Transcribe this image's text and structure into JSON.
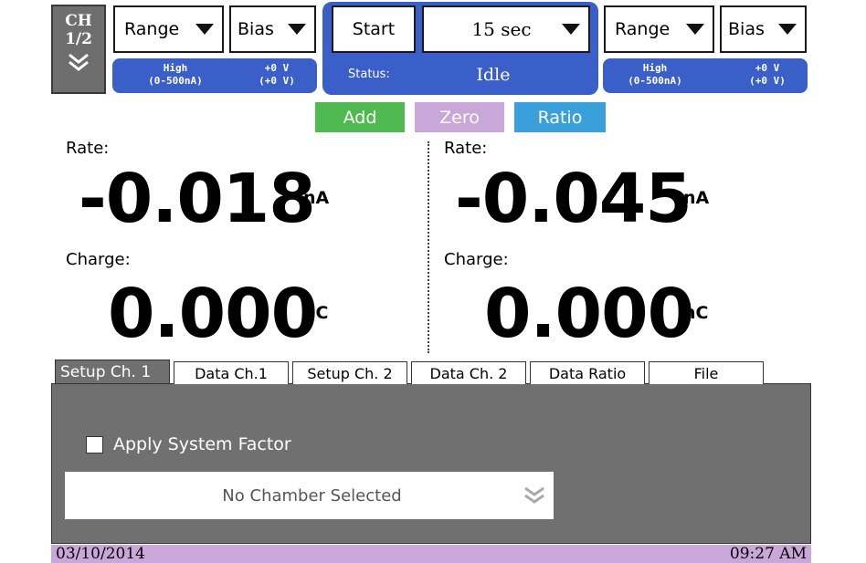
{
  "channel": {
    "label_line1": "CH",
    "label_line2": "1/2",
    "icon": "double-chevron-down-icon"
  },
  "left": {
    "range_label": "Range",
    "bias_label": "Bias",
    "range_info_line1": "High",
    "range_info_line2": "(0-500nA)",
    "bias_info_line1": "+0 V",
    "bias_info_line2": "(+0 V)"
  },
  "right": {
    "range_label": "Range",
    "bias_label": "Bias",
    "range_info_line1": "High",
    "range_info_line2": "(0-500nA)",
    "bias_info_line1": "+0 V",
    "bias_info_line2": "(+0 V)"
  },
  "acquisition": {
    "start_label": "Start",
    "time_value": "15 sec",
    "status_label": "Status:",
    "status_value": "Idle"
  },
  "modes": {
    "add": "Add",
    "zero": "Zero",
    "ratio": "Ratio"
  },
  "readings": {
    "ch1": {
      "rate_label": "Rate:",
      "rate_value": "-0.018",
      "rate_unit": "nA",
      "charge_label": "Charge:",
      "charge_value": "0.000",
      "charge_unit": "nC"
    },
    "ch2": {
      "rate_label": "Rate:",
      "rate_value": "-0.045",
      "rate_unit": "nA",
      "charge_label": "Charge:",
      "charge_value": "0.000",
      "charge_unit": "nC"
    }
  },
  "tabs": [
    {
      "label": "Setup Ch. 1",
      "active": true
    },
    {
      "label": "Data Ch.1",
      "active": false
    },
    {
      "label": "Setup Ch. 2",
      "active": false
    },
    {
      "label": "Data Ch. 2",
      "active": false
    },
    {
      "label": "Data Ratio",
      "active": false
    },
    {
      "label": "File",
      "active": false
    }
  ],
  "setup": {
    "apply_system_factor_label": "Apply System Factor",
    "apply_system_factor_checked": false,
    "chamber_value": "No Chamber Selected"
  },
  "status_bar": {
    "date": "03/10/2014",
    "time": "09:27 AM"
  },
  "colors": {
    "accent_blue": "#3a5fc9",
    "add_green": "#4fba4f",
    "zero_purple": "#c9a7d8",
    "ratio_blue": "#3aa0dc",
    "panel_gray": "#707070"
  }
}
